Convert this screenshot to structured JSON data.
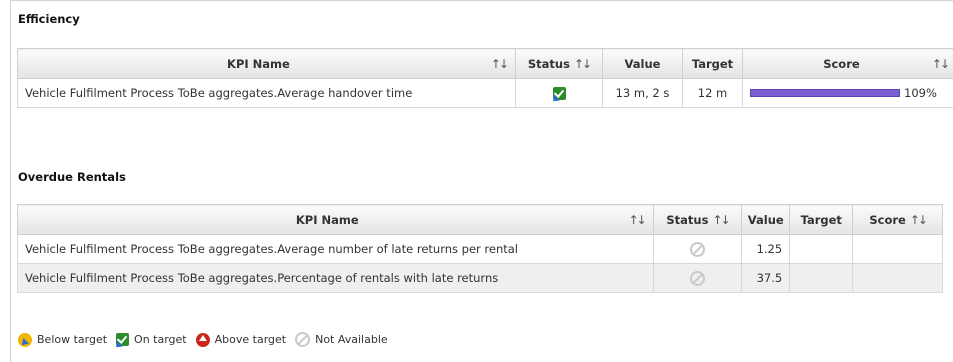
{
  "sections": [
    {
      "title": "Efficiency",
      "headers": {
        "kpi": "KPI Name",
        "status": "Status",
        "value": "Value",
        "target": "Target",
        "score": "Score"
      },
      "sort_glyph": "↑↓",
      "rows": [
        {
          "kpi": "Vehicle Fulfilment Process ToBe aggregates.Average handover time",
          "status": "On target",
          "value": "13 m, 2 s",
          "target": "12 m",
          "score_pct": "109%",
          "score_fraction": 1.09
        }
      ]
    },
    {
      "title": "Overdue Rentals",
      "headers": {
        "kpi": "KPI Name",
        "status": "Status",
        "value": "Value",
        "target": "Target",
        "score": "Score"
      },
      "sort_glyph": "↑↓",
      "rows": [
        {
          "kpi": "Vehicle Fulfilment Process ToBe aggregates.Average number of late returns per rental",
          "status": "Not Available",
          "value": "1.25",
          "target": "",
          "score": ""
        },
        {
          "kpi": "Vehicle Fulfilment Process ToBe aggregates.Percentage of rentals with late returns",
          "status": "Not Available",
          "value": "37.5",
          "target": "",
          "score": ""
        }
      ]
    }
  ],
  "legend": [
    {
      "label": "Below target",
      "icon": "below-target-icon"
    },
    {
      "label": "On target",
      "icon": "on-target-icon"
    },
    {
      "label": "Above target",
      "icon": "above-target-icon"
    },
    {
      "label": "Not Available",
      "icon": "not-available-icon"
    }
  ],
  "colors": {
    "score_bar": "#7a5fd1",
    "on_target": "#2e8b2e",
    "below_target": "#f2b600",
    "above_target": "#c9271d",
    "not_available": "#c9c9c9"
  }
}
